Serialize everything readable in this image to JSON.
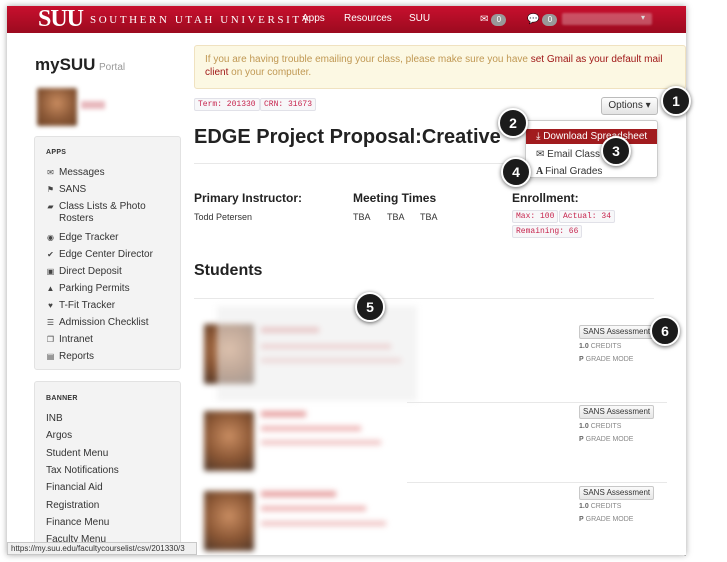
{
  "navbar": {
    "logo": "SUU",
    "brand": "SOUTHERN UTAH UNIVERSITY",
    "links": [
      "Apps",
      "Resources",
      "SUU"
    ],
    "mail_count": "0",
    "chat_count": "0"
  },
  "sidebar": {
    "title": "mySUU",
    "subtitle": "Portal",
    "apps_heading": "APPS",
    "apps": [
      {
        "label": "Messages",
        "icon": "envelope-icon"
      },
      {
        "label": "SANS",
        "icon": "flag-icon"
      },
      {
        "label": "Class Lists & Photo Rosters",
        "icon": "book-icon"
      },
      {
        "label": "Edge Tracker",
        "icon": "globe-icon"
      },
      {
        "label": "Edge Center Director",
        "icon": "check-circle-icon"
      },
      {
        "label": "Direct Deposit",
        "icon": "money-icon"
      },
      {
        "label": "Parking Permits",
        "icon": "road-icon"
      },
      {
        "label": "T-Fit Tracker",
        "icon": "heart-icon"
      },
      {
        "label": "Admission Checklist",
        "icon": "list-icon"
      },
      {
        "label": "Intranet",
        "icon": "copy-icon"
      },
      {
        "label": "Reports",
        "icon": "table-icon"
      }
    ],
    "banner_heading": "BANNER",
    "banner": [
      "INB",
      "Argos",
      "Student Menu",
      "Tax Notifications",
      "Financial Aid",
      "Registration",
      "Finance Menu",
      "Faculty Menu"
    ]
  },
  "alert": {
    "text_before": "If you are having trouble emailing your class, please make sure you have ",
    "link": "set Gmail as your default mail client",
    "text_after": " on your computer."
  },
  "course": {
    "term": "Term: 201330",
    "crn": "CRN: 31673",
    "title": "EDGE Project Proposal:Creative"
  },
  "options": {
    "button_label": "Options",
    "items": [
      "Download Spreadsheet",
      "Email Class",
      "Final Grades"
    ]
  },
  "info": {
    "instructor_label": "Primary Instructor:",
    "instructor": "Todd Petersen",
    "meeting_label": "Meeting Times",
    "meeting_times": [
      "TBA",
      "TBA",
      "TBA"
    ],
    "enrollment_label": "Enrollment:",
    "max": "Max: 100",
    "actual": "Actual: 34",
    "remaining": "Remaining: 66"
  },
  "students": {
    "heading": "Students",
    "rows": [
      {
        "button": "SANS Assessment",
        "credits_value": "1.0",
        "credits_label": "CREDITS",
        "mode_value": "P",
        "mode_label": "GRADE MODE"
      },
      {
        "button": "SANS Assessment",
        "credits_value": "1.0",
        "credits_label": "CREDITS",
        "mode_value": "P",
        "mode_label": "GRADE MODE"
      },
      {
        "button": "SANS Assessment",
        "credits_value": "1.0",
        "credits_label": "CREDITS",
        "mode_value": "P",
        "mode_label": "GRADE MODE"
      }
    ]
  },
  "status_url": "https://my.suu.edu/facultycourselist/csv/201330/3",
  "callouts": [
    "1",
    "2",
    "3",
    "4",
    "5",
    "6"
  ],
  "colors": {
    "brand_red": "#c8102e",
    "active_menu": "#a11b1e",
    "alert_bg": "#fcf8e3",
    "code_red": "#c7254e"
  }
}
